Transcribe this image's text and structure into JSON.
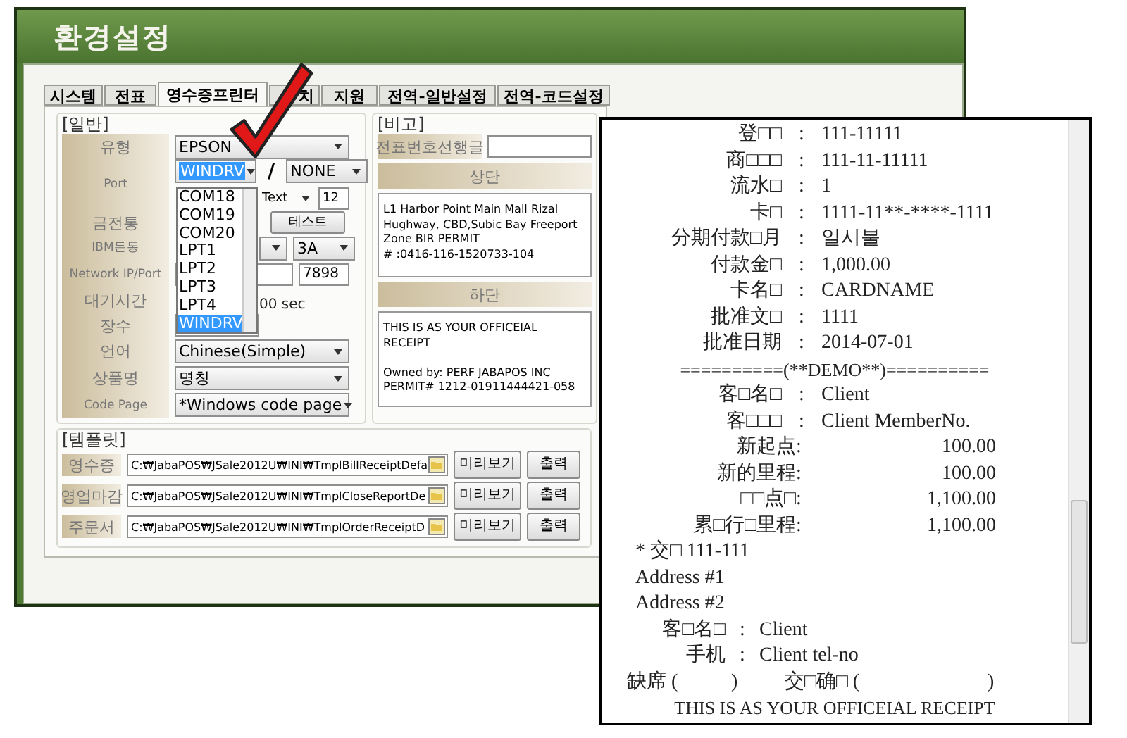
{
  "window": {
    "title": "환경설정"
  },
  "tabs": [
    {
      "label": "시스템",
      "selected": false
    },
    {
      "label": "전표",
      "selected": false
    },
    {
      "label": "영수증프린터",
      "selected": true
    },
    {
      "label": "치",
      "selected": false
    },
    {
      "label": "지원",
      "selected": false
    },
    {
      "label": "전역-일반설정",
      "selected": false
    },
    {
      "label": "전역-코드설정",
      "selected": false
    }
  ],
  "general": {
    "title": "[일반]",
    "rows": [
      {
        "kind": "select",
        "label": "유형",
        "value": "EPSON"
      },
      {
        "kind": "port",
        "label": "Port",
        "value": "WINDRV",
        "separator": "/",
        "second_value": "NONE",
        "font": "Text",
        "size": "12"
      },
      {
        "kind": "button",
        "label": "금전통",
        "button": "테스트"
      },
      {
        "kind": "dual_select",
        "label": "IBM돈통",
        "second_value": "3A"
      },
      {
        "kind": "ip",
        "label": "Network IP/Port",
        "port": "7898"
      },
      {
        "kind": "text",
        "label": "대기시간",
        "value": "00 sec"
      },
      {
        "kind": "spinner",
        "label": "장수"
      },
      {
        "kind": "select",
        "label": "언어",
        "value": "Chinese(Simple)"
      },
      {
        "kind": "select",
        "label": "상품명",
        "value": "명칭"
      },
      {
        "kind": "select",
        "label": "Code Page",
        "value": "*Windows code page"
      }
    ]
  },
  "port_dropdown": {
    "items": [
      {
        "label": "COM18",
        "selected": false
      },
      {
        "label": "COM19",
        "selected": false
      },
      {
        "label": "COM20",
        "selected": false
      },
      {
        "label": "LPT1",
        "selected": false
      },
      {
        "label": "LPT2",
        "selected": false
      },
      {
        "label": "LPT3",
        "selected": false
      },
      {
        "label": "LPT4",
        "selected": false
      },
      {
        "label": "WINDRV",
        "selected": true
      }
    ]
  },
  "remarks": {
    "title": "[비고]",
    "prefix_label": "전표번호선행글",
    "header_title": "상단",
    "header_text": "L1 Harbor Point Main Mall Rizal\nHughway, CBD,Subic Bay Freeport\nZone BIR PERMIT\n# :0416-116-1520733-104",
    "footer_title": "하단",
    "footer_text": "THIS IS AS YOUR OFFICEIAL\nRECEIPT\n\nOwned by: PERF JABAPOS INC\nPERMIT# 1212-01911444421-058"
  },
  "templates": {
    "title": "[템플릿]",
    "rows": [
      {
        "label": "영수증",
        "path": "C:₩JabaPOS₩JSale2012U₩INI₩TmplBillReceiptDefa",
        "preview": "미리보기",
        "print": "출력"
      },
      {
        "label": "영업마감",
        "path": "C:₩JabaPOS₩JSale2012U₩INI₩TmplCloseReportDe",
        "preview": "미리보기",
        "print": "출력"
      },
      {
        "label": "주문서",
        "path": "C:₩JabaPOS₩JSale2012U₩INI₩TmplOrderReceiptD",
        "preview": "미리보기",
        "print": "출력"
      }
    ]
  },
  "receipt": {
    "lines": [
      {
        "kind": "pair",
        "label": "登□□",
        "sep": ":",
        "value": "111-11111"
      },
      {
        "kind": "pair",
        "label": "商□□□",
        "sep": ":",
        "value": "111-11-11111"
      },
      {
        "kind": "pair",
        "label": "流水□",
        "sep": ":",
        "value": "1"
      },
      {
        "kind": "pair",
        "label": "卡□",
        "sep": ":",
        "value": "1111-11**-****-1111"
      },
      {
        "kind": "pair",
        "label": "分期付款□月",
        "sep": ":",
        "value": "일시불"
      },
      {
        "kind": "pair",
        "label": "付款金□",
        "sep": ":",
        "value": "1,000.00"
      },
      {
        "kind": "pair",
        "label": "卡名□",
        "sep": ":",
        "value": "CARDNAME"
      },
      {
        "kind": "pair",
        "label": "批准文□",
        "sep": ":",
        "value": "1111"
      },
      {
        "kind": "pair",
        "label": "批准日期",
        "sep": ":",
        "value": "2014-07-01"
      },
      {
        "kind": "center",
        "text": "==========(**DEMO**)=========="
      },
      {
        "kind": "pair",
        "label": "客□名□",
        "sep": ":",
        "value": "Client"
      },
      {
        "kind": "pair",
        "label": "客□□□",
        "sep": ":",
        "value": "Client MemberNo."
      },
      {
        "kind": "amount",
        "label": "新起点",
        "sep": ":",
        "value": "100.00"
      },
      {
        "kind": "amount",
        "label": "新的里程",
        "sep": ":",
        "value": "100.00"
      },
      {
        "kind": "amount",
        "label": "□□点□",
        "sep": ":",
        "value": "1,100.00"
      },
      {
        "kind": "amount",
        "label": "累□行□里程",
        "sep": ":",
        "value": "1,100.00"
      },
      {
        "kind": "plain",
        "text": "* 交□ 111-111"
      },
      {
        "kind": "plain",
        "text": "Address #1"
      },
      {
        "kind": "plain",
        "text": "Address #2"
      },
      {
        "kind": "short_pair",
        "label": "客□名□",
        "sep": ":",
        "value": "Client"
      },
      {
        "kind": "short_pair",
        "label": "手机",
        "sep": ":",
        "value": "Client tel-no"
      },
      {
        "kind": "sign",
        "first": "缺席 (",
        "second": ")",
        "third": "交□确□ (",
        "fourth": ")"
      },
      {
        "kind": "center",
        "text": "THIS IS AS YOUR OFFICEIAL RECEIPT"
      }
    ]
  }
}
